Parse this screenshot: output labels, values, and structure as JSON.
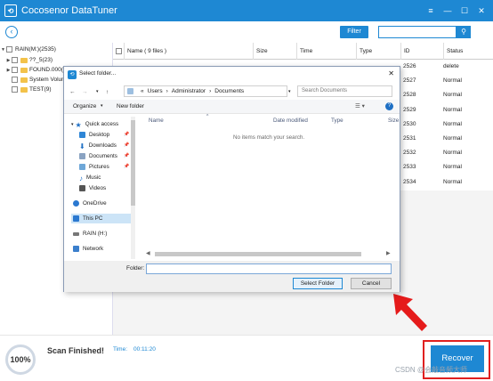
{
  "app": {
    "title": "Cocosenor DataTuner",
    "icon": "app-logo-icon",
    "accent": "#1e88d3"
  },
  "toolbar": {
    "filter_label": "Filter",
    "search_value": ""
  },
  "tree": {
    "items": [
      {
        "label": "RAIN(M:)(2535)",
        "expanded": true
      },
      {
        "label": "??_5(23)"
      },
      {
        "label": "FOUND.000(2"
      },
      {
        "label": "System Volum"
      },
      {
        "label": "TEST(9)"
      }
    ]
  },
  "table": {
    "headers": {
      "name": "Name ( 9 files )",
      "size": "Size",
      "time": "Time",
      "type": "Type",
      "id": "ID",
      "status": "Status"
    },
    "rows": [
      {
        "id": "2526",
        "status": "delete"
      },
      {
        "id": "2527",
        "status": "Normal"
      },
      {
        "id": "2528",
        "status": "Normal"
      },
      {
        "id": "2529",
        "status": "Normal"
      },
      {
        "id": "2530",
        "status": "Normal"
      },
      {
        "id": "2531",
        "status": "Normal"
      },
      {
        "id": "2532",
        "status": "Normal"
      },
      {
        "id": "2533",
        "status": "Normal"
      },
      {
        "id": "2534",
        "status": "Normal"
      }
    ]
  },
  "dialog": {
    "title": "Select folder...",
    "path": {
      "prefix": "«",
      "users": "Users",
      "admin": "Administrator",
      "documents": "Documents"
    },
    "search_placeholder": "Search Documents",
    "organize": "Organize",
    "new_folder": "New folder",
    "nav": {
      "quick_access": "Quick access",
      "desktop": "Desktop",
      "downloads": "Downloads",
      "documents": "Documents",
      "pictures": "Pictures",
      "music": "Music",
      "videos": "Videos",
      "onedrive": "OneDrive",
      "this_pc": "This PC",
      "rain": "RAIN (H:)",
      "network": "Network"
    },
    "columns": {
      "name": "Name",
      "date": "Date modified",
      "type": "Type",
      "size": "Size"
    },
    "empty_message": "No items match your search.",
    "folder_label": "Folder:",
    "folder_value": "",
    "select_button": "Select Folder",
    "cancel_button": "Cancel"
  },
  "status": {
    "progress": "100%",
    "scan_text": "Scan Finished!",
    "time_label": "Time:",
    "time_value": "00:11:20",
    "recover_button": "Recover"
  },
  "watermark": "CSDN @会敲音频大师"
}
